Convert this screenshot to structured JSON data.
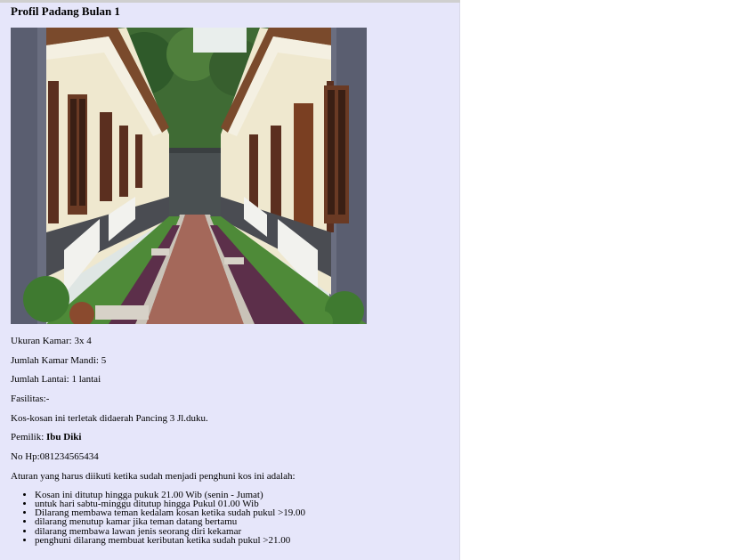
{
  "page": {
    "title": "Profil Padang Bulan 1"
  },
  "photo": {
    "subject": "boarding-house-courtyard-photo"
  },
  "details": {
    "ukuran_label": "Ukuran Kamar:",
    "ukuran_value": "3x 4",
    "kamar_mandi_label": "Jumlah Kamar Mandi:",
    "kamar_mandi_value": "5",
    "lantai_label": "Jumlah Lantai:",
    "lantai_value": "1 lantai",
    "fasilitas_label": "Fasilitas:-",
    "lokasi_text": "Kos-kosan ini terletak didaerah Pancing 3 Jl.duku.",
    "pemilik_label": "Pemilik:",
    "pemilik_value": "Ibu Diki",
    "hp_label": "No Hp:",
    "hp_value": "081234565434"
  },
  "rules": {
    "intro": "Aturan yang harus diikuti ketika sudah menjadi penghuni kos ini adalah:",
    "items": [
      "Kosan ini ditutup hingga pukuk 21.00 Wib (senin - Jumat)",
      "untuk hari sabtu-minggu ditutup hingga Pukul 01.00 Wib",
      "Dilarang membawa teman kedalam kosan ketika sudah pukul >19.00",
      "dilarang menutup kamar jika teman datang bertamu",
      "dilarang membawa lawan jenis seorang diri kekamar",
      "penghuni dilarang membuat keributan ketika sudah pukul >21.00"
    ]
  },
  "colors": {
    "panel_background": "#e6e6fa",
    "wall_grey": "#5a5e70",
    "wall_cream": "#efe8cf",
    "path_brick": "#a4685a",
    "foliage": "#4e8a38"
  }
}
